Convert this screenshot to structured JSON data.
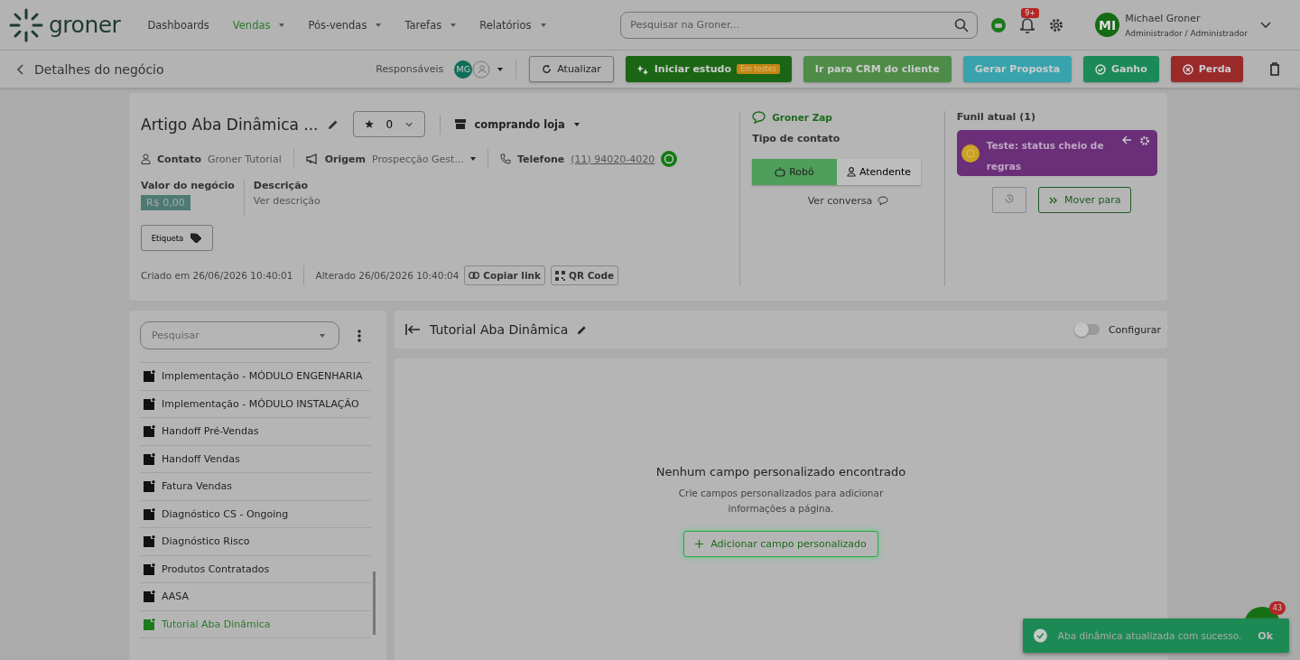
{
  "nav": {
    "logo": "groner",
    "menu": [
      {
        "label": "Dashboards",
        "selected": false,
        "dropdown": false
      },
      {
        "label": "Vendas",
        "selected": true,
        "dropdown": true
      },
      {
        "label": "Pós-vendas",
        "selected": false,
        "dropdown": true
      },
      {
        "label": "Tarefas",
        "selected": false,
        "dropdown": true
      },
      {
        "label": "Relatórios",
        "selected": false,
        "dropdown": true
      }
    ],
    "search": {
      "placeholder": "Pesquisar na Groner..."
    },
    "notification_badge": "9+",
    "user": {
      "initials": "MI",
      "name": "Michael Groner",
      "role": "Administrador / Administrador"
    }
  },
  "header": {
    "title": "Detalhes do negócio",
    "responsaveis_label": "Responsáveis",
    "avatar_initials": "MG",
    "buttons": [
      {
        "label": "Atualizar",
        "kind": "refresh"
      },
      {
        "label": "Iniciar estudo",
        "kind": "study",
        "badge": "Em testes"
      },
      {
        "label": "Ir para CRM do cliente",
        "kind": "crm"
      },
      {
        "label": "Gerar Proposta",
        "kind": "proposal"
      },
      {
        "label": "Ganho",
        "kind": "won"
      },
      {
        "label": "Perda",
        "kind": "lost"
      }
    ]
  },
  "deal": {
    "title": "Artigo Aba Dinâmica ...",
    "rating": "0",
    "stage": "comprando loja",
    "contact": {
      "label": "Contato",
      "value": "Groner Tutorial"
    },
    "origin": {
      "label": "Origem",
      "value": "Prospecção Gest..."
    },
    "phone": {
      "label": "Telefone",
      "value": "(11) 94020-4020"
    },
    "value": {
      "label": "Valor do negócio",
      "value": "R$ 0,00"
    },
    "description": {
      "label": "Descrição",
      "value": "Ver descrição"
    },
    "tag_button": "Etiqueta",
    "created": "Criado em 26/06/2026 10:40:01",
    "altered": "Alterado 26/06/2026 10:40:04",
    "copy_link": "Copiar link",
    "qr_code": "QR Code"
  },
  "zap": {
    "title": "Groner Zap",
    "type_label": "Tipo de contato",
    "contact_types": [
      {
        "label": "Robô",
        "selected": true,
        "kind": "robot"
      },
      {
        "label": "Atendente",
        "selected": false,
        "kind": "person"
      }
    ],
    "view_conversation": "Ver conversa"
  },
  "funnel": {
    "title": "Funil atual (1)",
    "stage": "Teste: status cheio de regras",
    "move_button": "Mover para"
  },
  "tabs_sidebar": {
    "search": {
      "placeholder": "Pesquisar"
    },
    "items": [
      {
        "label": "Implementação - MÓDULO ENGENHARIA",
        "selected": false
      },
      {
        "label": "Implementação - MÓDULO INSTALAÇÃO",
        "selected": false
      },
      {
        "label": "Handoff Pré-Vendas",
        "selected": false
      },
      {
        "label": "Handoff Vendas",
        "selected": false
      },
      {
        "label": "Fatura Vendas",
        "selected": false
      },
      {
        "label": "Diagnóstico CS - Ongoing",
        "selected": false
      },
      {
        "label": "Diagnóstico Risco",
        "selected": false
      },
      {
        "label": "Produtos Contratados",
        "selected": false
      },
      {
        "label": "AASA",
        "selected": false
      },
      {
        "label": "Tutorial Aba Dinâmica",
        "selected": true
      }
    ]
  },
  "panel": {
    "title": "Tutorial Aba Dinâmica",
    "configure": {
      "label": "Configurar",
      "on": false
    },
    "empty_title": "Nenhum campo personalizado encontrado",
    "empty_text": "Crie campos personalizados para adicionar informações a página.",
    "add_button": "Adicionar campo personalizado"
  },
  "toast": {
    "message": "Aba dinâmica atualizada com sucesso.",
    "action": "Ok"
  },
  "chat_badge": "43"
}
